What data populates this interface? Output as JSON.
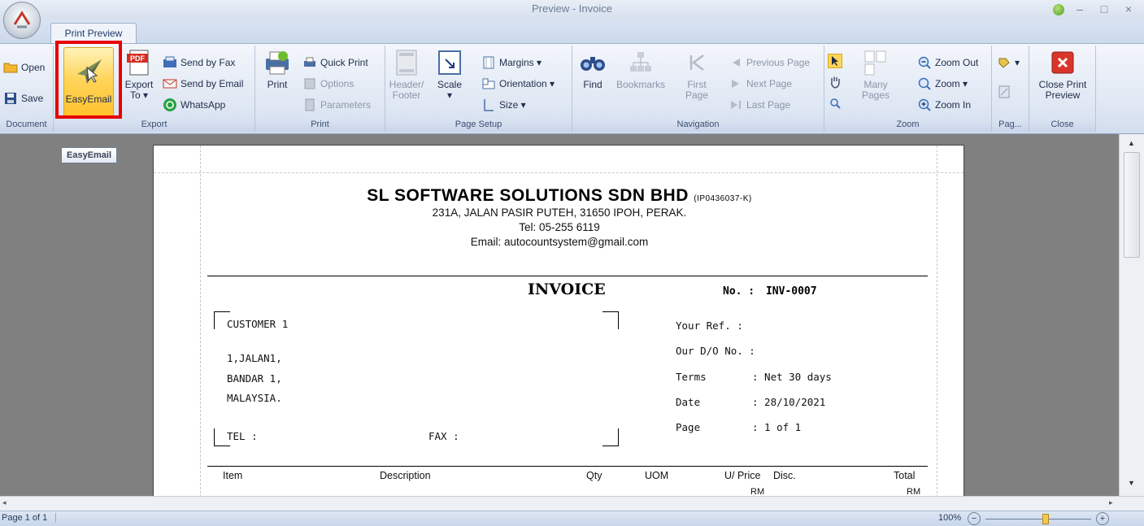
{
  "window": {
    "title": "Preview - Invoice",
    "controls": [
      "–",
      "□",
      "×"
    ]
  },
  "ribbon_tab": "Print Preview",
  "groups": {
    "document": {
      "label": "Document",
      "open": "Open",
      "save": "Save"
    },
    "export": {
      "label": "Export",
      "easyemail": "EasyEmail",
      "export_to_1": "Export",
      "export_to_2": "To ▾",
      "send_fax": "Send by Fax",
      "send_email": "Send by Email",
      "whatsapp": "WhatsApp"
    },
    "print": {
      "label": "Print",
      "print": "Print",
      "quick_print": "Quick Print",
      "options": "Options",
      "parameters": "Parameters"
    },
    "page_setup": {
      "label": "Page Setup",
      "header_footer_1": "Header/",
      "header_footer_2": "Footer",
      "scale": "Scale",
      "scale_arrow": "▾",
      "margins": "Margins ▾",
      "orientation": "Orientation ▾",
      "size": "Size ▾"
    },
    "navigation": {
      "label": "Navigation",
      "find": "Find",
      "bookmarks": "Bookmarks",
      "first_page_1": "First",
      "first_page_2": "Page",
      "previous_page": "Previous Page",
      "next_page": "Next Page",
      "last_page": "Last Page"
    },
    "zoom": {
      "label": "Zoom",
      "many_pages": "Many Pages",
      "zoom_out": "Zoom Out",
      "zoom": "Zoom ▾",
      "zoom_in": "Zoom In"
    },
    "page": {
      "label": "Pag..."
    },
    "close": {
      "label": "Close",
      "close_1": "Close Print",
      "close_2": "Preview"
    }
  },
  "tooltip": "EasyEmail",
  "invoice": {
    "company_name": "SL SOFTWARE SOLUTIONS SDN BHD",
    "company_reg": "(IP0436037-K)",
    "address": "231A, JALAN PASIR PUTEH, 31650 IPOH, PERAK.",
    "tel": "Tel: 05-255 6119",
    "email": "Email: autocountsystem@gmail.com",
    "title": "INVOICE",
    "no_label": "No.  :",
    "no_value": "INV-0007",
    "customer": "CUSTOMER 1",
    "addr1": "1,JALAN1,",
    "addr2": "BANDAR 1,",
    "addr3": "MALAYSIA.",
    "tel_label": "TEL  :",
    "fax_label": "FAX  :",
    "your_ref": "Your Ref.    :",
    "our_do": "Our D/O No. :",
    "terms_label": "Terms",
    "terms_value": ":  Net 30 days",
    "date_label": "Date",
    "date_value": ":  28/10/2021",
    "page_label": "Page",
    "page_value": ":  1 of 1",
    "columns": [
      "Item",
      "Description",
      "Qty",
      "UOM",
      "U/ Price",
      "Disc.",
      "Total"
    ],
    "col_sub": [
      "RM",
      "RM"
    ]
  },
  "status": {
    "page": "Page 1 of 1",
    "zoom": "100%"
  }
}
